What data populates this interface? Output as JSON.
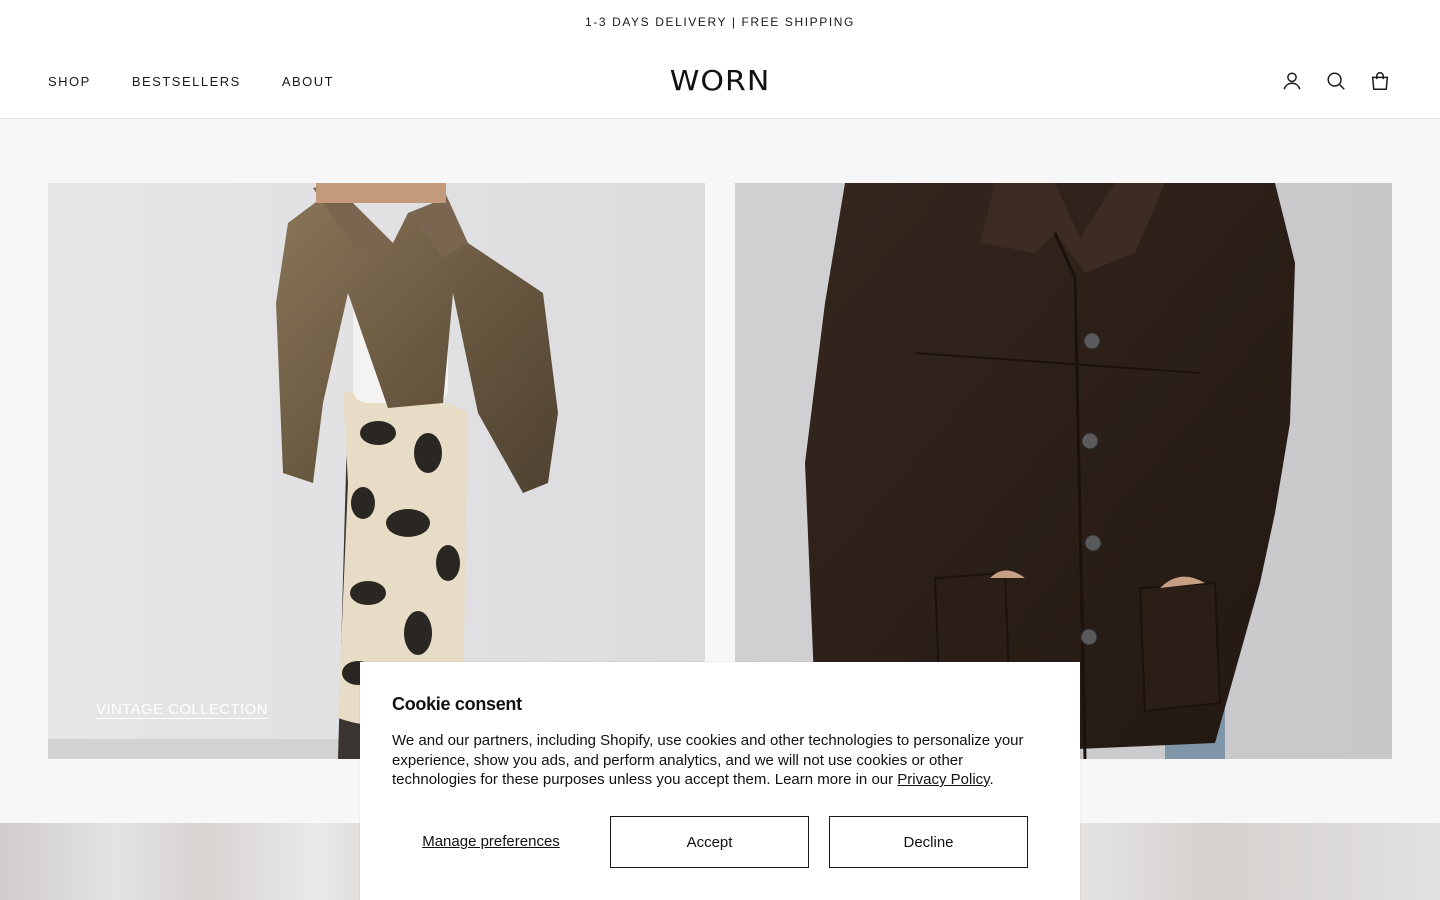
{
  "announcement": {
    "text": "1-3 DAYS DELIVERY | FREE SHIPPING"
  },
  "header": {
    "nav": [
      {
        "label": "SHOP"
      },
      {
        "label": "BESTSELLERS"
      },
      {
        "label": "ABOUT"
      }
    ],
    "logo": "WORN",
    "icons": [
      "account-icon",
      "search-icon",
      "cart-icon"
    ]
  },
  "collections": [
    {
      "label": "VINTAGE COLLECTION",
      "image": "model-leather-jacket-cow-print-skirt"
    },
    {
      "label": "",
      "image": "model-brown-suede-jacket"
    }
  ],
  "cookie": {
    "title": "Cookie consent",
    "body": "We and our partners, including Shopify, use cookies and other technologies to personalize your experience, show you ads, and perform analytics, and we will not use cookies or other technologies for these purposes unless you accept them. Learn more in our ",
    "policy_link": "Privacy Policy",
    "body_end": ".",
    "manage_label": "Manage preferences",
    "accept_label": "Accept",
    "decline_label": "Decline"
  },
  "colors": {
    "background": "#f7f7f7",
    "header": "#ffffff",
    "text": "#1a1a1a",
    "suede": "#2b1f18"
  }
}
